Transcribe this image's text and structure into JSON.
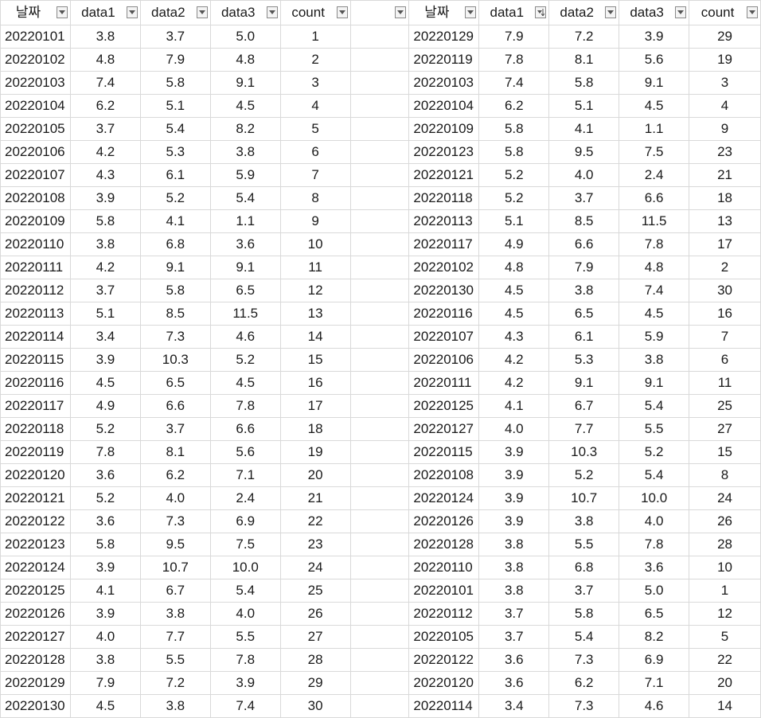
{
  "sheet": {
    "left_table": {
      "headers": [
        "날짜",
        "data1",
        "data2",
        "data3",
        "count"
      ],
      "rows": [
        [
          "20220101",
          "3.8",
          "3.7",
          "5.0",
          "1"
        ],
        [
          "20220102",
          "4.8",
          "7.9",
          "4.8",
          "2"
        ],
        [
          "20220103",
          "7.4",
          "5.8",
          "9.1",
          "3"
        ],
        [
          "20220104",
          "6.2",
          "5.1",
          "4.5",
          "4"
        ],
        [
          "20220105",
          "3.7",
          "5.4",
          "8.2",
          "5"
        ],
        [
          "20220106",
          "4.2",
          "5.3",
          "3.8",
          "6"
        ],
        [
          "20220107",
          "4.3",
          "6.1",
          "5.9",
          "7"
        ],
        [
          "20220108",
          "3.9",
          "5.2",
          "5.4",
          "8"
        ],
        [
          "20220109",
          "5.8",
          "4.1",
          "1.1",
          "9"
        ],
        [
          "20220110",
          "3.8",
          "6.8",
          "3.6",
          "10"
        ],
        [
          "20220111",
          "4.2",
          "9.1",
          "9.1",
          "11"
        ],
        [
          "20220112",
          "3.7",
          "5.8",
          "6.5",
          "12"
        ],
        [
          "20220113",
          "5.1",
          "8.5",
          "11.5",
          "13"
        ],
        [
          "20220114",
          "3.4",
          "7.3",
          "4.6",
          "14"
        ],
        [
          "20220115",
          "3.9",
          "10.3",
          "5.2",
          "15"
        ],
        [
          "20220116",
          "4.5",
          "6.5",
          "4.5",
          "16"
        ],
        [
          "20220117",
          "4.9",
          "6.6",
          "7.8",
          "17"
        ],
        [
          "20220118",
          "5.2",
          "3.7",
          "6.6",
          "18"
        ],
        [
          "20220119",
          "7.8",
          "8.1",
          "5.6",
          "19"
        ],
        [
          "20220120",
          "3.6",
          "6.2",
          "7.1",
          "20"
        ],
        [
          "20220121",
          "5.2",
          "4.0",
          "2.4",
          "21"
        ],
        [
          "20220122",
          "3.6",
          "7.3",
          "6.9",
          "22"
        ],
        [
          "20220123",
          "5.8",
          "9.5",
          "7.5",
          "23"
        ],
        [
          "20220124",
          "3.9",
          "10.7",
          "10.0",
          "24"
        ],
        [
          "20220125",
          "4.1",
          "6.7",
          "5.4",
          "25"
        ],
        [
          "20220126",
          "3.9",
          "3.8",
          "4.0",
          "26"
        ],
        [
          "20220127",
          "4.0",
          "7.7",
          "5.5",
          "27"
        ],
        [
          "20220128",
          "3.8",
          "5.5",
          "7.8",
          "28"
        ],
        [
          "20220129",
          "7.9",
          "7.2",
          "3.9",
          "29"
        ],
        [
          "20220130",
          "4.5",
          "3.8",
          "7.4",
          "30"
        ]
      ]
    },
    "right_table": {
      "headers": [
        "날짜",
        "data1",
        "data2",
        "data3",
        "count"
      ],
      "sorted_column": "data1",
      "sort_direction": "descending",
      "rows": [
        [
          "20220129",
          "7.9",
          "7.2",
          "3.9",
          "29"
        ],
        [
          "20220119",
          "7.8",
          "8.1",
          "5.6",
          "19"
        ],
        [
          "20220103",
          "7.4",
          "5.8",
          "9.1",
          "3"
        ],
        [
          "20220104",
          "6.2",
          "5.1",
          "4.5",
          "4"
        ],
        [
          "20220109",
          "5.8",
          "4.1",
          "1.1",
          "9"
        ],
        [
          "20220123",
          "5.8",
          "9.5",
          "7.5",
          "23"
        ],
        [
          "20220121",
          "5.2",
          "4.0",
          "2.4",
          "21"
        ],
        [
          "20220118",
          "5.2",
          "3.7",
          "6.6",
          "18"
        ],
        [
          "20220113",
          "5.1",
          "8.5",
          "11.5",
          "13"
        ],
        [
          "20220117",
          "4.9",
          "6.6",
          "7.8",
          "17"
        ],
        [
          "20220102",
          "4.8",
          "7.9",
          "4.8",
          "2"
        ],
        [
          "20220130",
          "4.5",
          "3.8",
          "7.4",
          "30"
        ],
        [
          "20220116",
          "4.5",
          "6.5",
          "4.5",
          "16"
        ],
        [
          "20220107",
          "4.3",
          "6.1",
          "5.9",
          "7"
        ],
        [
          "20220106",
          "4.2",
          "5.3",
          "3.8",
          "6"
        ],
        [
          "20220111",
          "4.2",
          "9.1",
          "9.1",
          "11"
        ],
        [
          "20220125",
          "4.1",
          "6.7",
          "5.4",
          "25"
        ],
        [
          "20220127",
          "4.0",
          "7.7",
          "5.5",
          "27"
        ],
        [
          "20220115",
          "3.9",
          "10.3",
          "5.2",
          "15"
        ],
        [
          "20220108",
          "3.9",
          "5.2",
          "5.4",
          "8"
        ],
        [
          "20220124",
          "3.9",
          "10.7",
          "10.0",
          "24"
        ],
        [
          "20220126",
          "3.9",
          "3.8",
          "4.0",
          "26"
        ],
        [
          "20220128",
          "3.8",
          "5.5",
          "7.8",
          "28"
        ],
        [
          "20220110",
          "3.8",
          "6.8",
          "3.6",
          "10"
        ],
        [
          "20220101",
          "3.8",
          "3.7",
          "5.0",
          "1"
        ],
        [
          "20220112",
          "3.7",
          "5.8",
          "6.5",
          "12"
        ],
        [
          "20220105",
          "3.7",
          "5.4",
          "8.2",
          "5"
        ],
        [
          "20220122",
          "3.6",
          "7.3",
          "6.9",
          "22"
        ],
        [
          "20220120",
          "3.6",
          "6.2",
          "7.1",
          "20"
        ],
        [
          "20220114",
          "3.4",
          "7.3",
          "4.6",
          "14"
        ]
      ]
    },
    "icons": {
      "filter": "filter-dropdown-icon",
      "sorted": "sort-descending-filter-icon"
    },
    "colors": {
      "gridline": "#d9d9d9",
      "button_border": "#8a8a8a",
      "text": "#1a1a1a"
    }
  }
}
